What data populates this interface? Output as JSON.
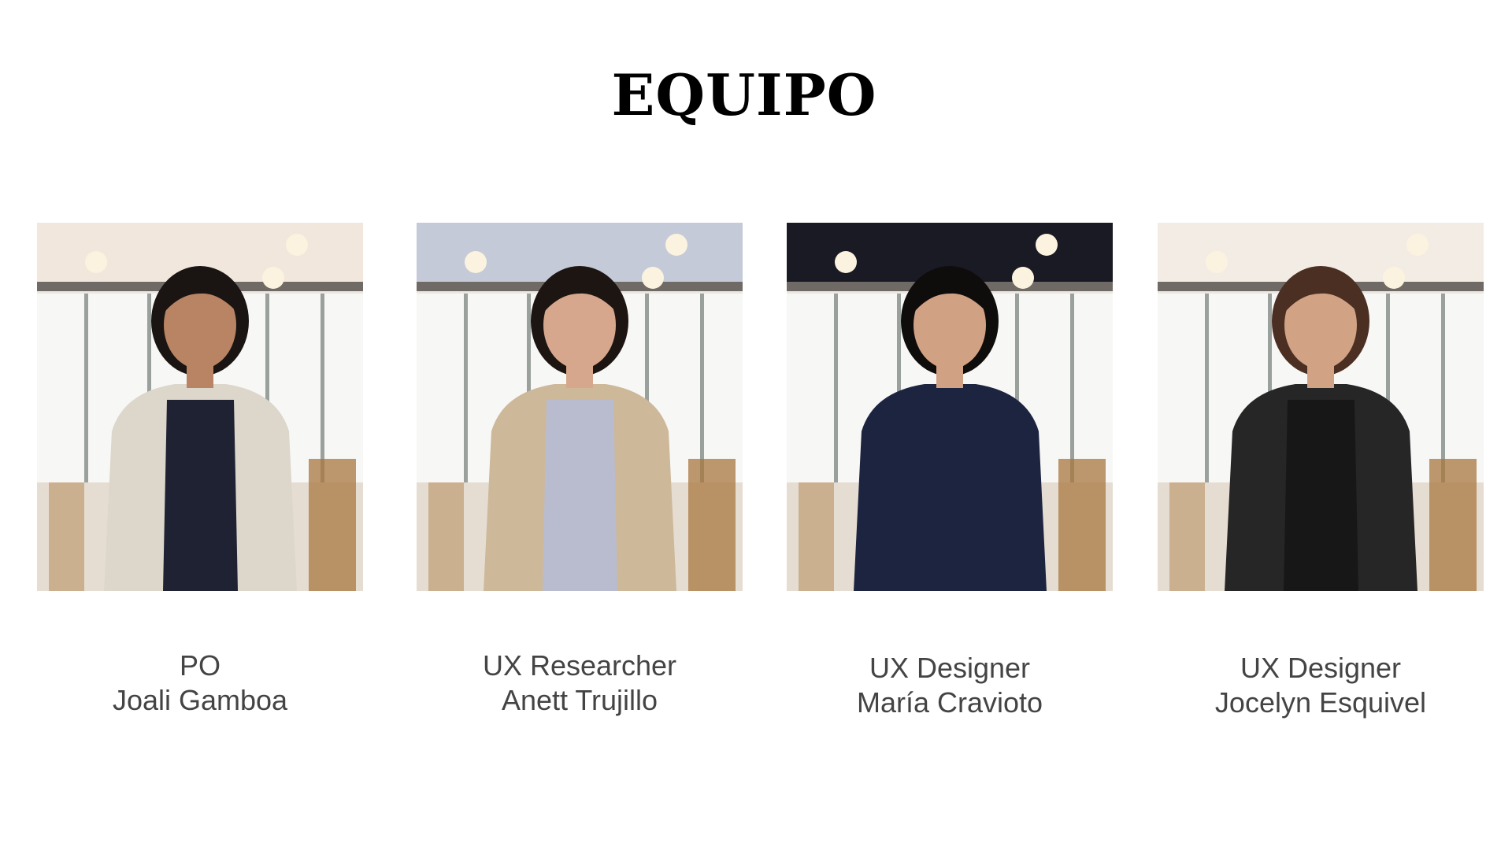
{
  "slide": {
    "title": "EQUIPO",
    "members": [
      {
        "role": "PO",
        "name": "Joali Gamboa",
        "top": "#f1e7dc",
        "outfit": "#1e2233",
        "jacket": "#ddd6cb",
        "hair": "#1a1412",
        "skin": "#b88463"
      },
      {
        "role": "UX Researcher",
        "name": "Anett Trujillo",
        "top": "#c5cad8",
        "outfit": "#b9bccf",
        "jacket": "#cdb89a",
        "hair": "#1c1512",
        "skin": "#d6a78c"
      },
      {
        "role": "UX Designer",
        "name": "María Cravioto",
        "top": "#1a1a24",
        "outfit": "#1d2440",
        "jacket": "#1d2440",
        "hair": "#0f0c0c",
        "skin": "#d1a184"
      },
      {
        "role": "UX Designer",
        "name": "Jocelyn Esquivel",
        "top": "#f3ece4",
        "outfit": "#171717",
        "jacket": "#262626",
        "hair": "#4a2f22",
        "skin": "#d2a285"
      }
    ]
  }
}
